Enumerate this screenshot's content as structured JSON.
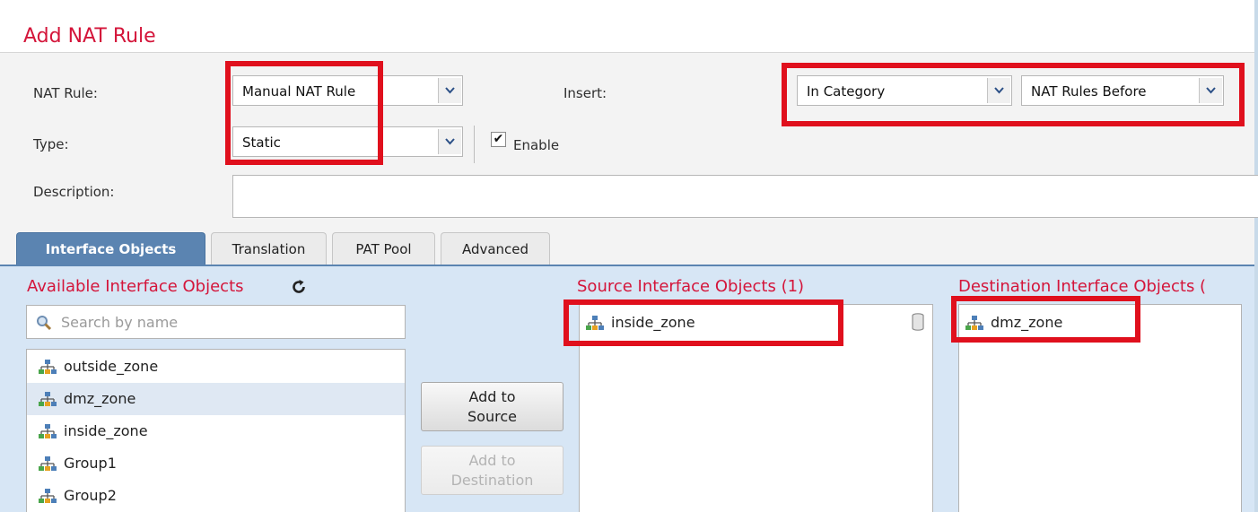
{
  "dialog": {
    "title": "Add NAT Rule"
  },
  "form": {
    "nat_rule_label": "NAT Rule:",
    "nat_rule_value": "Manual NAT Rule",
    "type_label": "Type:",
    "type_value": "Static",
    "enable_label": "Enable",
    "enable_checked": true,
    "insert_label": "Insert:",
    "insert_value": "In Category",
    "insert_position_value": "NAT Rules Before",
    "description_label": "Description:",
    "description_value": ""
  },
  "tabs": [
    {
      "label": "Interface Objects",
      "active": true
    },
    {
      "label": "Translation",
      "active": false
    },
    {
      "label": "PAT Pool",
      "active": false
    },
    {
      "label": "Advanced",
      "active": false
    }
  ],
  "available": {
    "title": "Available Interface Objects",
    "search_placeholder": "Search by name",
    "items": [
      {
        "name": "outside_zone",
        "selected": false
      },
      {
        "name": "dmz_zone",
        "selected": true
      },
      {
        "name": "inside_zone",
        "selected": false
      },
      {
        "name": "Group1",
        "selected": false
      },
      {
        "name": "Group2",
        "selected": false
      }
    ]
  },
  "buttons": {
    "add_to_source_line1": "Add to",
    "add_to_source_line2": "Source",
    "add_to_destination_line1": "Add to",
    "add_to_destination_line2": "Destination"
  },
  "source": {
    "title": "Source Interface Objects (1)",
    "items": [
      "inside_zone"
    ]
  },
  "destination": {
    "title": "Destination Interface Objects (",
    "items": [
      "dmz_zone"
    ]
  },
  "icons": {
    "zone": "network-zone-icon",
    "refresh": "refresh-icon",
    "search": "search-icon",
    "delete": "trash-icon",
    "dropdown": "chevron-down-icon"
  },
  "colors": {
    "title": "#d4153a",
    "active_tab": "#5b84b1",
    "panel": "#d7e6f5",
    "highlight": "#e0101d"
  }
}
